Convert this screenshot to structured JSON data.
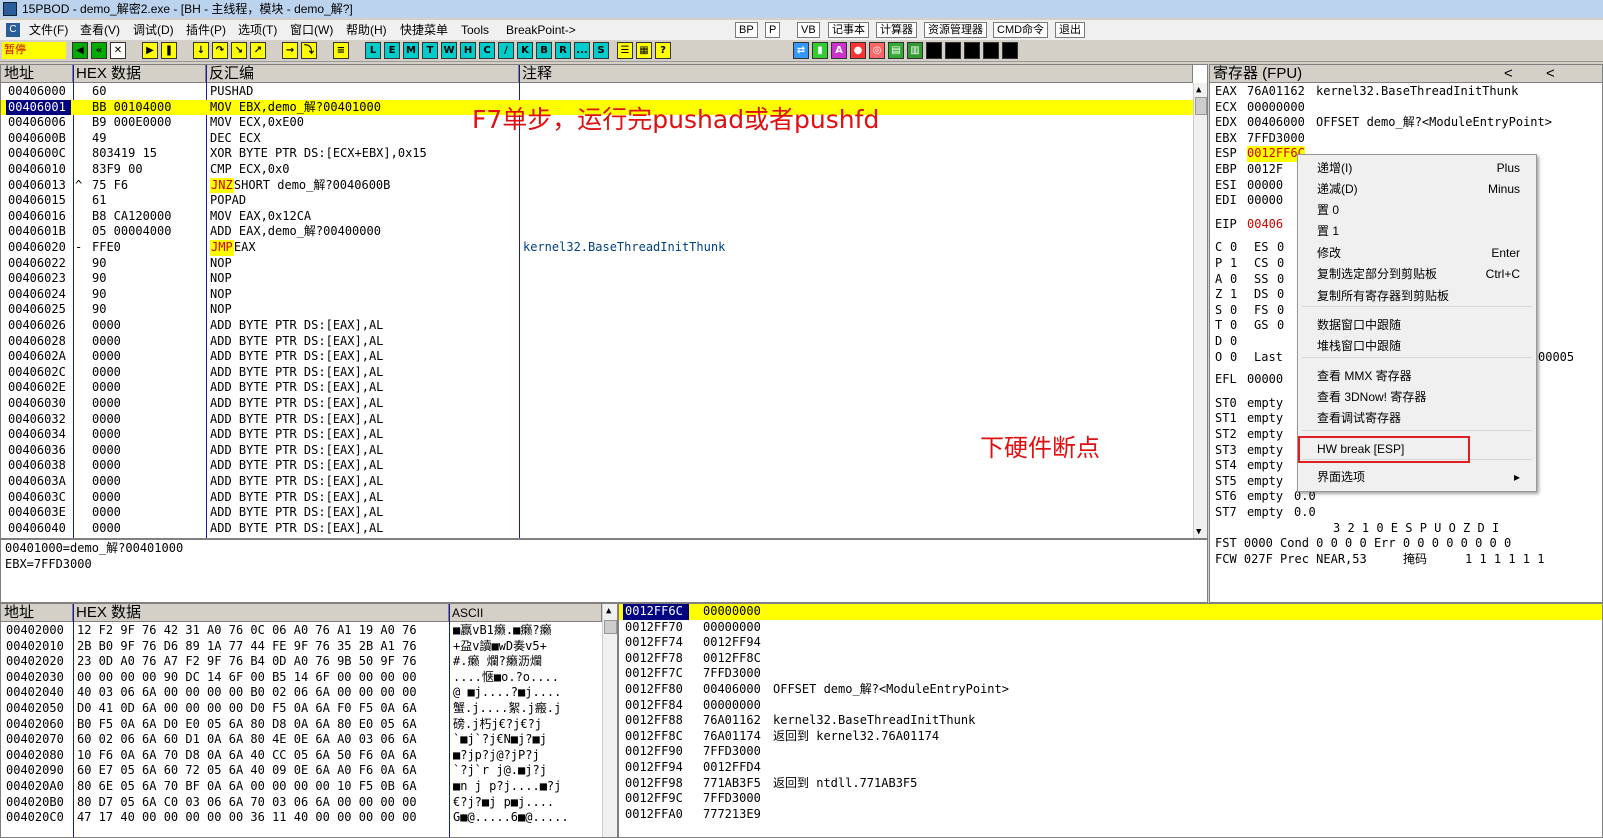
{
  "window": {
    "title": "15PBOD - demo_解密2.exe - [BH - 主线程，模块 - demo_解?]"
  },
  "menu": {
    "items": [
      "文件(F)",
      "查看(V)",
      "调试(D)",
      "插件(P)",
      "选项(T)",
      "窗口(W)",
      "帮助(H)",
      "快捷菜单",
      "Tools",
      "BreakPoint->"
    ],
    "buttons": [
      "BP",
      "P",
      "VB",
      "记事本",
      "计算器",
      "资源管理器",
      "CMD命令",
      "退出"
    ]
  },
  "toolbar": {
    "status": "暂停",
    "letters": [
      "L",
      "E",
      "M",
      "T",
      "W",
      "H",
      "C",
      "/",
      "K",
      "B",
      "R",
      "...",
      "S"
    ]
  },
  "disasm": {
    "headers": {
      "addr": "地址",
      "hex": "HEX 数据",
      "asm": "反汇编",
      "comment": "注释"
    },
    "rows": [
      {
        "a": "00406000",
        "m": "",
        "h": "60",
        "d": "PUSHAD",
        "n": ""
      },
      {
        "a": "00406001",
        "m": "",
        "h": "BB 00104000",
        "d": "MOV EBX,demo_解?00401000",
        "n": ""
      },
      {
        "a": "00406006",
        "m": "",
        "h": "B9 000E0000",
        "d": "MOV ECX,0xE00",
        "n": ""
      },
      {
        "a": "0040600B",
        "m": "",
        "h": "49",
        "d": "DEC ECX",
        "n": ""
      },
      {
        "a": "0040600C",
        "m": "",
        "h": "803419 15",
        "d": "XOR BYTE PTR DS:[ECX+EBX],0x15",
        "n": ""
      },
      {
        "a": "00406010",
        "m": "",
        "h": "83F9 00",
        "d": "CMP ECX,0x0",
        "n": ""
      },
      {
        "a": "00406013",
        "m": "^",
        "h": "75 F6",
        "d": "JNZ",
        "d2": " SHORT demo_解?0040600B",
        "n": ""
      },
      {
        "a": "00406015",
        "m": "",
        "h": "61",
        "d": "POPAD",
        "n": ""
      },
      {
        "a": "00406016",
        "m": "",
        "h": "B8 CA120000",
        "d": "MOV EAX,0x12CA",
        "n": ""
      },
      {
        "a": "0040601B",
        "m": "",
        "h": "05 00004000",
        "d": "ADD EAX,demo_解?00400000",
        "n": ""
      },
      {
        "a": "00406020",
        "m": "-",
        "h": "FFE0",
        "d": "JMP",
        "d2": " EAX",
        "n": "kernel32.BaseThreadInitThunk"
      },
      {
        "a": "00406022",
        "m": "",
        "h": "90",
        "d": "NOP",
        "n": ""
      },
      {
        "a": "00406023",
        "m": "",
        "h": "90",
        "d": "NOP",
        "n": ""
      },
      {
        "a": "00406024",
        "m": "",
        "h": "90",
        "d": "NOP",
        "n": ""
      },
      {
        "a": "00406025",
        "m": "",
        "h": "90",
        "d": "NOP",
        "n": ""
      },
      {
        "a": "00406026",
        "m": "",
        "h": "0000",
        "d": "ADD BYTE PTR DS:[EAX],AL",
        "n": ""
      },
      {
        "a": "00406028",
        "m": "",
        "h": "0000",
        "d": "ADD BYTE PTR DS:[EAX],AL",
        "n": ""
      },
      {
        "a": "0040602A",
        "m": "",
        "h": "0000",
        "d": "ADD BYTE PTR DS:[EAX],AL",
        "n": ""
      },
      {
        "a": "0040602C",
        "m": "",
        "h": "0000",
        "d": "ADD BYTE PTR DS:[EAX],AL",
        "n": ""
      },
      {
        "a": "0040602E",
        "m": "",
        "h": "0000",
        "d": "ADD BYTE PTR DS:[EAX],AL",
        "n": ""
      },
      {
        "a": "00406030",
        "m": "",
        "h": "0000",
        "d": "ADD BYTE PTR DS:[EAX],AL",
        "n": ""
      },
      {
        "a": "00406032",
        "m": "",
        "h": "0000",
        "d": "ADD BYTE PTR DS:[EAX],AL",
        "n": ""
      },
      {
        "a": "00406034",
        "m": "",
        "h": "0000",
        "d": "ADD BYTE PTR DS:[EAX],AL",
        "n": ""
      },
      {
        "a": "00406036",
        "m": "",
        "h": "0000",
        "d": "ADD BYTE PTR DS:[EAX],AL",
        "n": ""
      },
      {
        "a": "00406038",
        "m": "",
        "h": "0000",
        "d": "ADD BYTE PTR DS:[EAX],AL",
        "n": ""
      },
      {
        "a": "0040603A",
        "m": "",
        "h": "0000",
        "d": "ADD BYTE PTR DS:[EAX],AL",
        "n": ""
      },
      {
        "a": "0040603C",
        "m": "",
        "h": "0000",
        "d": "ADD BYTE PTR DS:[EAX],AL",
        "n": ""
      },
      {
        "a": "0040603E",
        "m": "",
        "h": "0000",
        "d": "ADD BYTE PTR DS:[EAX],AL",
        "n": ""
      },
      {
        "a": "00406040",
        "m": "",
        "h": "0000",
        "d": "ADD BYTE PTR DS:[EAX],AL",
        "n": ""
      }
    ]
  },
  "info": {
    "line1": "00401000=demo_解?00401000",
    "line2": "EBX=7FFD3000"
  },
  "registers": {
    "title": "寄存器 (FPU)",
    "nav": [
      "<",
      "<"
    ],
    "gp": [
      {
        "n": "EAX",
        "v": "76A01162",
        "c": "kernel32.BaseThreadInitThunk"
      },
      {
        "n": "ECX",
        "v": "00000000",
        "c": ""
      },
      {
        "n": "EDX",
        "v": "00406000",
        "c": "OFFSET demo_解?<ModuleEntryPoint>"
      },
      {
        "n": "EBX",
        "v": "7FFD3000",
        "c": ""
      },
      {
        "n": "ESP",
        "v": "0012FF6C",
        "c": ""
      },
      {
        "n": "EBP",
        "v": "0012F",
        "c": ""
      },
      {
        "n": "ESI",
        "v": "00000",
        "c": ""
      },
      {
        "n": "EDI",
        "v": "00000",
        "c": ""
      }
    ],
    "eip": {
      "n": "EIP",
      "v": "00406"
    },
    "flags": [
      {
        "f": "C",
        "b": "0",
        "s": "ES",
        "sv": "0"
      },
      {
        "f": "P",
        "b": "1",
        "s": "CS",
        "sv": "0"
      },
      {
        "f": "A",
        "b": "0",
        "s": "SS",
        "sv": "0"
      },
      {
        "f": "Z",
        "b": "1",
        "s": "DS",
        "sv": "0"
      },
      {
        "f": "S",
        "b": "0",
        "s": "FS",
        "sv": "0"
      },
      {
        "f": "T",
        "b": "0",
        "s": "GS",
        "sv": "0"
      },
      {
        "f": "D",
        "b": "0",
        "s": "",
        "sv": ""
      },
      {
        "f": "O",
        "b": "0",
        "s": "Last",
        "sv": ""
      }
    ],
    "last_tail": "00005",
    "efl": {
      "n": "EFL",
      "v": "00000"
    },
    "st": [
      {
        "n": "ST0",
        "v": "empty",
        "x": ""
      },
      {
        "n": "ST1",
        "v": "empty",
        "x": ""
      },
      {
        "n": "ST2",
        "v": "empty",
        "x": ""
      },
      {
        "n": "ST3",
        "v": "empty",
        "x": ""
      },
      {
        "n": "ST4",
        "v": "empty",
        "x": ""
      },
      {
        "n": "ST5",
        "v": "empty",
        "x": ""
      },
      {
        "n": "ST6",
        "v": "empty",
        "x": "0.0"
      },
      {
        "n": "ST7",
        "v": "empty",
        "x": "0.0"
      }
    ],
    "bits_header": "3 2 1 0      E S P U O Z D I",
    "fst": "FST 0000  Cond 0 0 0 0  Err 0 0 0 0 0 0 0 0",
    "fcw_left": "FCW 027F  Prec NEAR,53",
    "fcw_mask": "掩码",
    "fcw_bits": "1 1 1 1 1 1"
  },
  "context_menu": {
    "items": [
      {
        "label": "递增(I)",
        "shortcut": "Plus"
      },
      {
        "label": "递减(D)",
        "shortcut": "Minus"
      },
      {
        "label": "置 0",
        "shortcut": ""
      },
      {
        "label": "置 1",
        "shortcut": ""
      },
      {
        "label": "修改",
        "shortcut": "Enter"
      },
      {
        "label": "复制选定部分到剪贴板",
        "shortcut": "Ctrl+C"
      },
      {
        "label": "复制所有寄存器到剪贴板",
        "shortcut": ""
      },
      {
        "label": "数据窗口中跟随",
        "shortcut": ""
      },
      {
        "label": "堆栈窗口中跟随",
        "shortcut": ""
      },
      {
        "label": "查看 MMX 寄存器",
        "shortcut": ""
      },
      {
        "label": "查看 3DNow! 寄存器",
        "shortcut": ""
      },
      {
        "label": "查看调试寄存器",
        "shortcut": ""
      },
      {
        "label": "HW break [ESP]",
        "shortcut": ""
      },
      {
        "label": "界面选项",
        "shortcut": "▸"
      }
    ]
  },
  "annotations": {
    "step": "F7单步，运行完pushad或者pushfd",
    "hwbp": "下硬件断点"
  },
  "dump": {
    "headers": {
      "addr": "地址",
      "hex": "HEX 数据",
      "ascii": "ASCII"
    },
    "rows": [
      {
        "a": "00402000",
        "h": "12 F2 9F 76 42 31 A0 76 0C 06 A0 76 A1 19 A0 76",
        "s": "■赢vB1癞.■癞?癞"
      },
      {
        "a": "00402010",
        "h": "2B B0 9F 76 D6 89 1A 77 44 FE 9F 76 35 2B A1 76",
        "s": "+盁v讀■wD奏v5+"
      },
      {
        "a": "00402020",
        "h": "23 0D A0 76 A7 F2 9F 76 B4 0D A0 76 9B 50 9F 76",
        "s": "#.癞 爛?癞沥爛"
      },
      {
        "a": "00402030",
        "h": "00 00 00 00 90 DC 14 6F 00 B5 14 6F 00 00 00 00",
        "s": "....惬■o.?o...."
      },
      {
        "a": "00402040",
        "h": "40 03 06 6A 00 00 00 00 B0 02 06 6A 00 00 00 00",
        "s": "@ ■j....?■j...."
      },
      {
        "a": "00402050",
        "h": "D0 41 0D 6A 00 00 00 00 D0 F5 0A 6A F0 F5 0A 6A",
        "s": "蟹.j....絮.j瘢.j"
      },
      {
        "a": "00402060",
        "h": "B0 F5 0A 6A D0 E0 05 6A 80 D8 0A 6A 80 E0 05 6A",
        "s": "磅.j朽j€?j€?j"
      },
      {
        "a": "00402070",
        "h": "60 02 06 6A 60 D1 0A 6A 80 4E 0E 6A A0 03 06 6A",
        "s": "`■j`?j€N■j?■j"
      },
      {
        "a": "00402080",
        "h": "10 F6 0A 6A 70 D8 0A 6A 40 CC 05 6A 50 F6 0A 6A",
        "s": "■?jp?j@?jP?j"
      },
      {
        "a": "00402090",
        "h": "60 E7 05 6A 60 72 05 6A 40 09 0E 6A A0 F6 0A 6A",
        "s": "`?j`r j@.■j?j"
      },
      {
        "a": "004020A0",
        "h": "80 6E 05 6A 70 BF 0A 6A 00 00 00 00 10 F5 0B 6A",
        "s": "■n j p?j....■?j"
      },
      {
        "a": "004020B0",
        "h": "80 D7 05 6A C0 03 06 6A 70 03 06 6A 00 00 00 00",
        "s": "€?j?■j p■j...."
      },
      {
        "a": "004020C0",
        "h": "47 17 40 00 00 00 00 00 36 11 40 00 00 00 00 00",
        "s": "G■@.....6■@....."
      }
    ]
  },
  "stack": {
    "rows": [
      {
        "a": "0012FF6C",
        "v": "00000000",
        "c": ""
      },
      {
        "a": "0012FF70",
        "v": "00000000",
        "c": ""
      },
      {
        "a": "0012FF74",
        "v": "0012FF94",
        "c": ""
      },
      {
        "a": "0012FF78",
        "v": "0012FF8C",
        "c": ""
      },
      {
        "a": "0012FF7C",
        "v": "7FFD3000",
        "c": ""
      },
      {
        "a": "0012FF80",
        "v": "00406000",
        "c": "OFFSET demo_解?<ModuleEntryPoint>"
      },
      {
        "a": "0012FF84",
        "v": "00000000",
        "c": ""
      },
      {
        "a": "0012FF88",
        "v": "76A01162",
        "c": "kernel32.BaseThreadInitThunk"
      },
      {
        "a": "0012FF8C",
        "v": "76A01174",
        "c": "返回到 kernel32.76A01174"
      },
      {
        "a": "0012FF90",
        "v": "7FFD3000",
        "c": ""
      },
      {
        "a": "0012FF94",
        "v": "0012FFD4",
        "c": ""
      },
      {
        "a": "0012FF98",
        "v": "771AB3F5",
        "c": "返回到 ntdll.771AB3F5"
      },
      {
        "a": "0012FF9C",
        "v": "7FFD3000",
        "c": ""
      },
      {
        "a": "0012FFA0",
        "v": "777213E9",
        "c": ""
      }
    ]
  },
  "colors": {
    "selection": "#ffff00",
    "address_highlight": "#000080",
    "annotation": "#e01010",
    "jump": "#d00000",
    "comment": "#004080"
  }
}
